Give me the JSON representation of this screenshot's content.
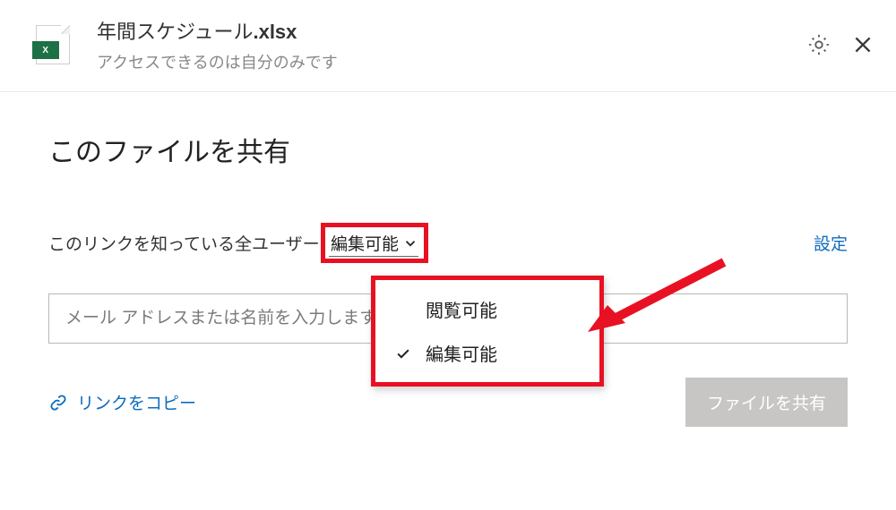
{
  "header": {
    "file_name": "年間スケジュール",
    "file_ext": ".xlsx",
    "subtitle": "アクセスできるのは自分のみです",
    "badge": "X"
  },
  "main": {
    "title": "このファイルを共有",
    "perm_label_prefix": "このリンクを知っている全ユーザー: ",
    "perm_current": "編集可能",
    "settings_link": "設定",
    "email_placeholder": "メール アドレスまたは名前を入力します",
    "copy_link": "リンクをコピー",
    "share_btn": "ファイルを共有"
  },
  "dropdown": {
    "options": [
      {
        "label": "閲覧可能",
        "selected": false
      },
      {
        "label": "編集可能",
        "selected": true
      }
    ]
  }
}
